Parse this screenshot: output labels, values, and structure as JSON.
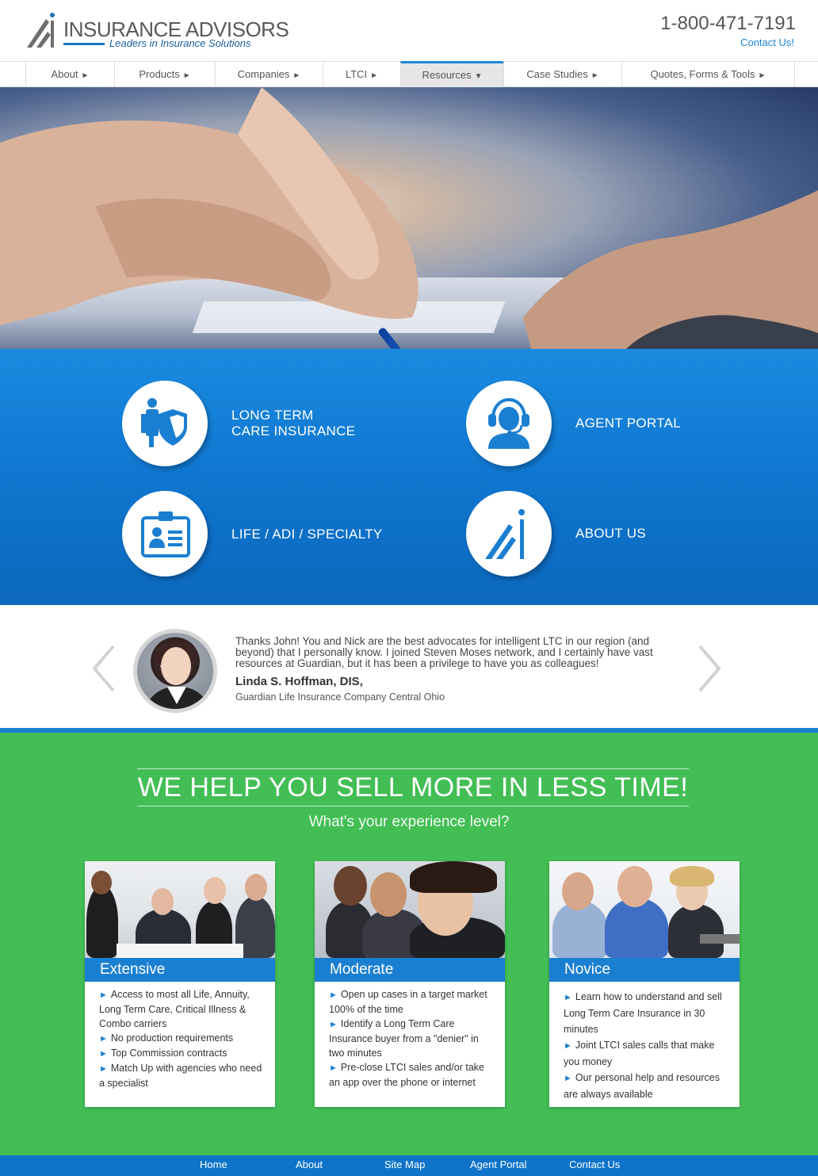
{
  "header": {
    "logo_name": "INSURANCE ADVISORS",
    "logo_tagline": "Leaders in Insurance Solutions",
    "phone": "1-800-471-7191",
    "contact_link": "Contact Us!"
  },
  "nav": {
    "items": [
      {
        "label": "About",
        "arrow": "►"
      },
      {
        "label": "Products",
        "arrow": "►"
      },
      {
        "label": "Companies",
        "arrow": "►"
      },
      {
        "label": "LTCI",
        "arrow": "►"
      },
      {
        "label": "Resources",
        "arrow": "▼",
        "active": true
      },
      {
        "label": "Case Studies",
        "arrow": "►"
      },
      {
        "label": "Quotes, Forms & Tools",
        "arrow": "►"
      }
    ]
  },
  "features": [
    {
      "line1": "LONG TERM",
      "line2": "CARE INSURANCE",
      "icon": "shield-person-icon"
    },
    {
      "line1": "AGENT PORTAL",
      "line2": "",
      "icon": "headset-agent-icon"
    },
    {
      "line1": "LIFE / ADI / SPECIALTY",
      "line2": "",
      "icon": "id-card-icon"
    },
    {
      "line1": "ABOUT US",
      "line2": "",
      "icon": "logo-mark-icon"
    }
  ],
  "testimonial": {
    "quote": "Thanks John! You and Nick are the best advocates for intelligent LTC in our region (and beyond) that I personally know. I joined Steven Moses network, and I certainly have vast resources at Guardian, but it has been a privilege to have you as colleagues!",
    "name": "Linda S. Hoffman, DIS,",
    "org": "Guardian Life Insurance Company Central Ohio"
  },
  "promo": {
    "title": "WE HELP YOU SELL MORE IN LESS TIME!",
    "subtitle": "What's your experience level?"
  },
  "cards": [
    {
      "title": "Extensive",
      "items": [
        "Access to most all Life, Annuity, Long Term Care, Critical Illness & Combo carriers",
        "No production requirements",
        "Top Commission contracts",
        "Match Up with agencies who need a specialist"
      ]
    },
    {
      "title": "Moderate",
      "items": [
        "Open up cases in a target market 100% of the time",
        "Identify a Long Term Care Insurance buyer from a \"denier\" in two minutes",
        "Pre-close LTCI sales and/or take an app over the phone or internet"
      ]
    },
    {
      "title": "Novice",
      "items": [
        "Learn how to understand and sell Long Term Care Insurance in 30 minutes",
        "Joint LTCI sales calls that make you money",
        "Our personal help and resources are always available"
      ]
    }
  ],
  "footer": {
    "links": [
      "Home",
      "About",
      "Site Map",
      "Agent Portal",
      "Contact Us"
    ]
  },
  "colors": {
    "brand_blue": "#1b7fd1",
    "green": "#43be55",
    "footer_blue": "#0f74c9"
  }
}
